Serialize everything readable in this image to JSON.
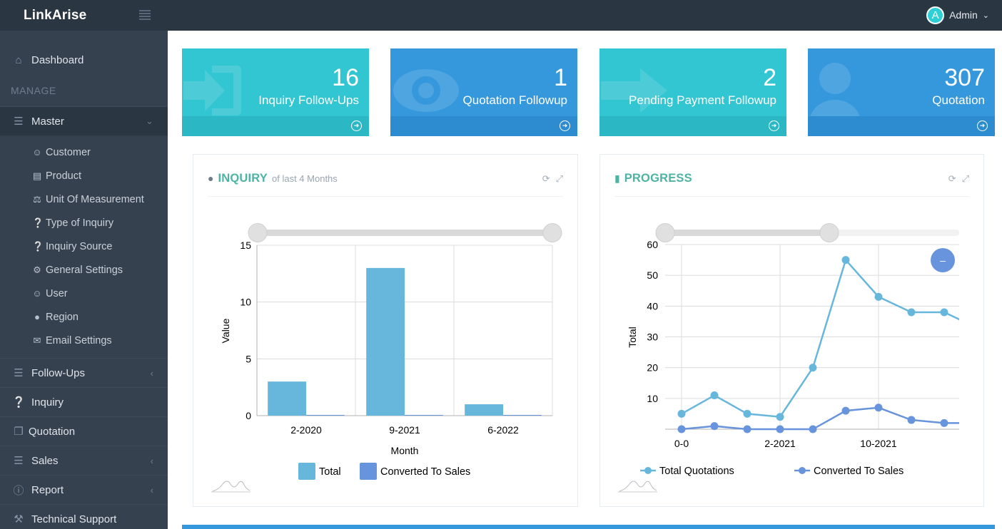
{
  "app": {
    "brand": "LinkArise",
    "user": {
      "initial": "A",
      "name": "Admin"
    }
  },
  "sidebar": {
    "heading": "MANAGE",
    "items": [
      {
        "label": "Dashboard",
        "icon": "home-icon"
      },
      {
        "label": "Master",
        "icon": "list-icon"
      },
      {
        "label": "Follow-Ups",
        "icon": "list-icon"
      },
      {
        "label": "Inquiry",
        "icon": "question-icon"
      },
      {
        "label": "Quotation",
        "icon": "copy-icon"
      },
      {
        "label": "Sales",
        "icon": "list-icon"
      },
      {
        "label": "Report",
        "icon": "info-icon"
      },
      {
        "label": "Technical Support",
        "icon": "wrench-icon"
      }
    ],
    "master_items": [
      {
        "label": "Customer",
        "icon": "user-icon"
      },
      {
        "label": "Product",
        "icon": "product-icon"
      },
      {
        "label": "Unit Of Measurement",
        "icon": "balance-icon"
      },
      {
        "label": "Type of Inquiry",
        "icon": "question-icon"
      },
      {
        "label": "Inquiry Source",
        "icon": "question-icon"
      },
      {
        "label": "General Settings",
        "icon": "gear-icon"
      },
      {
        "label": "User",
        "icon": "user-icon"
      },
      {
        "label": "Region",
        "icon": "map-pin-icon"
      },
      {
        "label": "Email Settings",
        "icon": "envelope-icon"
      }
    ]
  },
  "cards": [
    {
      "value": "16",
      "label": "Inquiry Follow-Ups",
      "color": "#32c5d2"
    },
    {
      "value": "1",
      "label": "Quotation Followup",
      "color": "#3598dc"
    },
    {
      "value": "2",
      "label": "Pending Payment Followup",
      "color": "#32c5d2"
    },
    {
      "value": "307",
      "label": "Quotation",
      "color": "#3598dc"
    }
  ],
  "inquiry_panel": {
    "title": "INQUIRY",
    "subtitle": "of last 4 Months"
  },
  "progress_panel": {
    "title": "PROGRESS"
  },
  "chart_data": [
    {
      "type": "bar",
      "categories": [
        "2-2020",
        "9-2021",
        "6-2022"
      ],
      "series": [
        {
          "name": "Total",
          "values": [
            3,
            13,
            1
          ],
          "color": "#67b7dc"
        },
        {
          "name": "Converted To Sales",
          "values": [
            0,
            0,
            0
          ],
          "color": "#6794dc"
        }
      ],
      "xlabel": "Month",
      "ylabel": "Value",
      "ylim": [
        0,
        15
      ],
      "yticks": [
        0,
        5,
        10,
        15
      ],
      "grid": true,
      "legend": "bottom"
    },
    {
      "type": "line",
      "x": [
        0,
        1,
        2,
        3,
        4,
        5,
        6,
        7,
        8,
        9
      ],
      "xticks": [
        "0-0",
        "2-2021",
        "10-2021"
      ],
      "series": [
        {
          "name": "Total Quotations",
          "values": [
            5,
            11,
            5,
            4,
            20,
            55,
            43,
            38,
            38,
            33
          ],
          "color": "#67b7dc"
        },
        {
          "name": "Converted To Sales",
          "values": [
            0,
            1,
            0,
            0,
            0,
            6,
            7,
            3,
            2,
            2
          ],
          "color": "#6794dc"
        }
      ],
      "xlabel": "",
      "ylabel": "Total",
      "ylim": [
        0,
        60
      ],
      "yticks": [
        10,
        20,
        30,
        40,
        50,
        60
      ],
      "grid": true,
      "legend": "bottom",
      "zoom_button_label": "–"
    }
  ]
}
